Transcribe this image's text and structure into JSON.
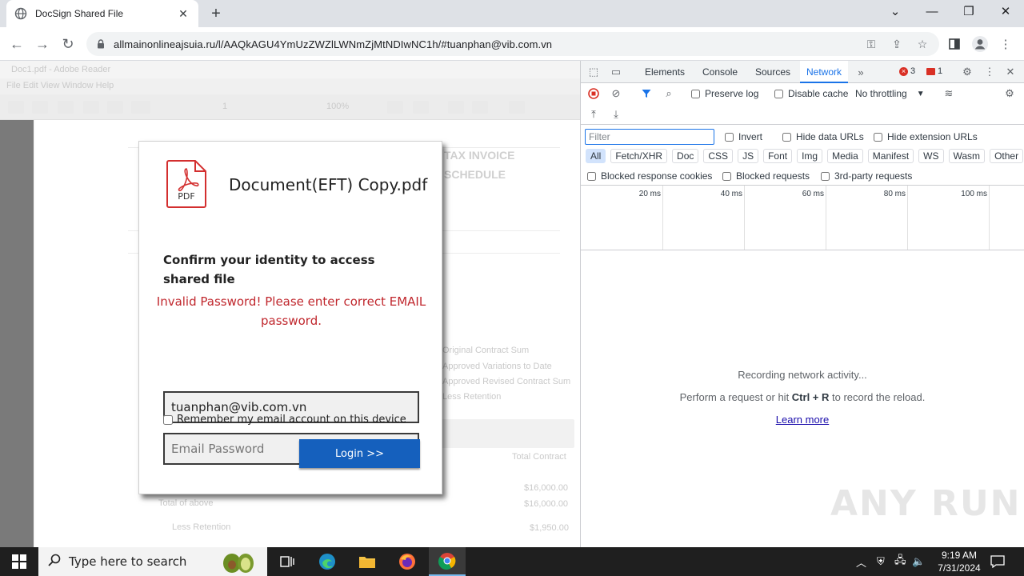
{
  "browser": {
    "tab_title": "DocSign Shared File",
    "url": "allmainonlineajsuia.ru/l/AAQkAGU4YmUzZWZlLWNmZjMtNDIwNC1h/#tuanphan@vib.com.vn"
  },
  "background_doc": {
    "title": "Doc1.pdf - Adobe Reader",
    "menu": "File   Edit   View   Window   Help",
    "zoom": "100%",
    "page": "1",
    "heading1": "TAX INVOICE",
    "heading2": "SCHEDULE",
    "line1": "Original Contract Sum",
    "line2": "Approved Variations to Date",
    "line3": "Approved Revised Contract Sum",
    "line4": "Less Retention",
    "total_label": "Total Contract",
    "amt1": "$16,000.00",
    "amt2": "$16,000.00",
    "amt3": "$1,950.00",
    "total_above": "Total of above",
    "less_ret": "Less Retention"
  },
  "modal": {
    "pdf_label": "PDF",
    "filename": "Document(EFT) Copy.pdf",
    "confirm_text": "Confirm your identity to access shared file",
    "error_text": "Invalid Password! Please enter correct EMAIL password.",
    "email_value": "tuanphan@vib.com.vn",
    "password_placeholder": "Email Password",
    "remember_label": "Remember my email account on this device",
    "login_label": "Login >>"
  },
  "devtools": {
    "tabs": [
      "Elements",
      "Console",
      "Sources",
      "Network"
    ],
    "active_tab": "Network",
    "errors_count": "3",
    "warnings_count": "1",
    "preserve_log": "Preserve log",
    "disable_cache": "Disable cache",
    "throttling": "No throttling",
    "filter_placeholder": "Filter",
    "invert": "Invert",
    "hide_data_urls": "Hide data URLs",
    "hide_ext_urls": "Hide extension URLs",
    "type_filters": [
      "All",
      "Fetch/XHR",
      "Doc",
      "CSS",
      "JS",
      "Font",
      "Img",
      "Media",
      "Manifest",
      "WS",
      "Wasm",
      "Other"
    ],
    "blocked_cookies": "Blocked response cookies",
    "blocked_requests": "Blocked requests",
    "third_party": "3rd-party requests",
    "timeline_ticks": [
      "20 ms",
      "40 ms",
      "60 ms",
      "80 ms",
      "100 ms"
    ],
    "recording": "Recording network activity...",
    "perform_prefix": "Perform a request or hit ",
    "perform_keys": "Ctrl + R",
    "perform_suffix": " to record the reload.",
    "learn_more": "Learn more"
  },
  "watermark": "ANY RUN",
  "taskbar": {
    "search_placeholder": "Type here to search",
    "time": "9:19 AM",
    "date": "7/31/2024"
  },
  "colors": {
    "accent_blue": "#1a73e8",
    "login_blue": "#1560bd",
    "error_red": "#c0272d",
    "pdf_red": "#d32f2f"
  }
}
